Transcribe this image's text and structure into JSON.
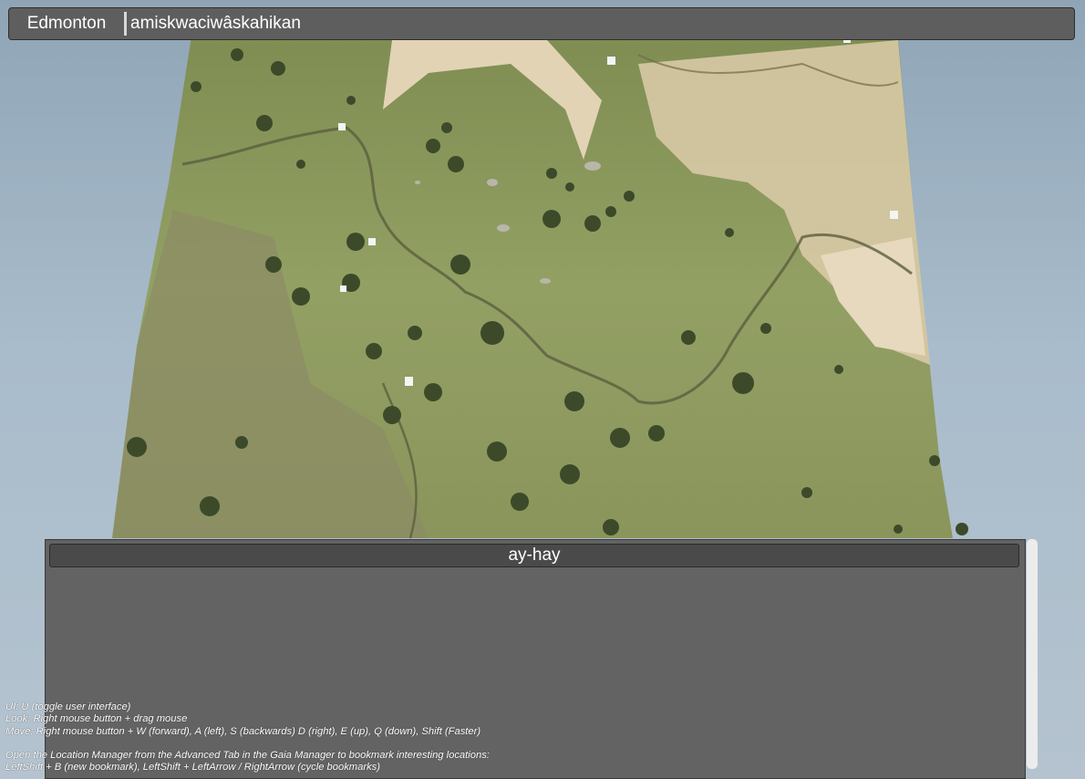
{
  "top_bar": {
    "location_label": "Edmonton",
    "location_field_value": "amiskwaciwâskahikan"
  },
  "panel": {
    "title": "ay-hay"
  },
  "help_lines": [
    "UI: U (toggle user interface)",
    "Look: Right mouse button + drag mouse",
    "Move: Right mouse button + W (forward), A (left), S (backwards) D (right), E (up), Q (down), Shift (Faster)",
    "",
    "Open the Location Manager from the Advanced Tab in the Gaia Manager to bookmark interesting locations:",
    "LeftShift + B (new bookmark), LeftShift + LeftArrow / RightArrow (cycle bookmarks)"
  ],
  "colors": {
    "sky": "#a9bccb",
    "grass": "#8e9a5e",
    "sand": "#e5d5b8",
    "panel": "#636363",
    "title_bar": "#4a4a4a"
  }
}
